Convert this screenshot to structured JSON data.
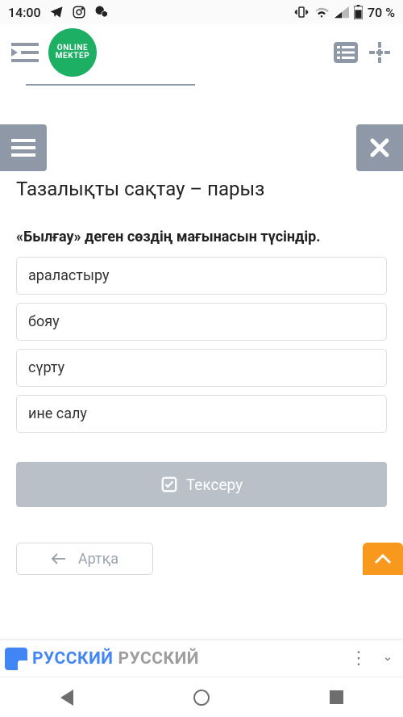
{
  "status": {
    "time": "14:00",
    "battery": "70 %"
  },
  "header": {
    "logo_line1": "ONLINE",
    "logo_line2": "MEKTEP"
  },
  "lesson": {
    "title": "Тазалықты сақтау – парыз",
    "question": "«Былғау» деген сөздің мағынасын түсіндір.",
    "options": [
      "араластыру",
      "бояу",
      "сүрту",
      "ине салу"
    ],
    "check_label": "Тексеру",
    "back_label": "Артқа"
  },
  "translate": {
    "lang_src": "РУССКИЙ",
    "lang_dst": "РУССКИЙ"
  }
}
